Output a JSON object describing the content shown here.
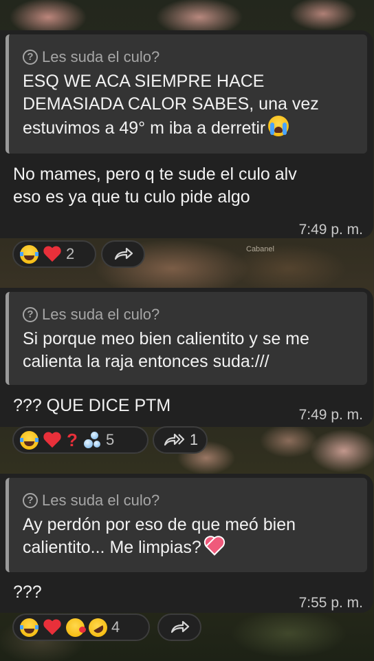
{
  "wallpaper": {
    "caption": "Cabanel"
  },
  "messages": [
    {
      "reply": {
        "icon": "help-circle-icon",
        "name": "Les suda el culo?",
        "text": "ESQ WE ACA SIEMPRE HACE DEMASIADA CALOR SABES, una vez estuvimos a 49° m iba a derretir",
        "emoji": "loudly-crying-face-icon"
      },
      "text_line1": "No mames, pero q te sude el culo alv",
      "text_line2": "eso es ya que tu culo pide algo",
      "time": "7:49 p. m.",
      "reactions": {
        "emojis": [
          "tears-of-joy-icon",
          "red-heart-icon"
        ],
        "count": "2"
      },
      "forward": {
        "icon": "forward-icon",
        "count": ""
      }
    },
    {
      "reply": {
        "icon": "help-circle-icon",
        "name": "Les suda el culo?",
        "text": "Si porque meo bien calientito y se me calienta la raja entonces suda:///"
      },
      "text_line1": "??? QUE DICE PTM",
      "time": "7:49 p. m.",
      "reactions": {
        "emojis": [
          "tears-of-joy-icon",
          "red-heart-icon",
          "red-question-icon",
          "sweat-droplets-icon"
        ],
        "count": "5"
      },
      "forward": {
        "icon": "forward-multiple-icon",
        "count": "1"
      }
    },
    {
      "reply": {
        "icon": "help-circle-icon",
        "name": "Les suda el culo?",
        "text": "Ay perdón por eso de que meó bien calientito... Me limpias?",
        "emoji": "heart-icon"
      },
      "text_line1": "???",
      "time": "7:55 p. m.",
      "reactions": {
        "emojis": [
          "tears-of-joy-icon",
          "red-heart-icon",
          "face-blowing-kiss-icon",
          "rolling-laughing-icon"
        ],
        "count": "4"
      },
      "forward": {
        "icon": "forward-icon",
        "count": ""
      }
    }
  ]
}
